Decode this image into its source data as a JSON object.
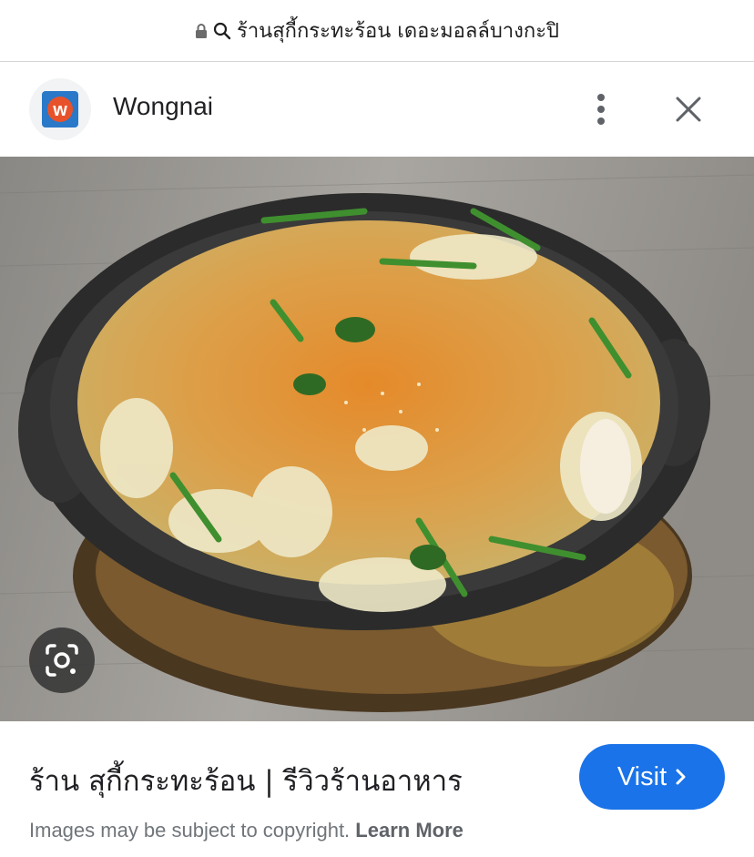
{
  "address_bar": {
    "url_text": "ร้านสุกี้กระทะร้อน เดอะมอลล์บางกะปิ",
    "lock_icon": "lock-icon",
    "search_icon": "search-icon"
  },
  "header": {
    "site_name": "Wongnai",
    "logo_letter": "w",
    "logo_color": "#e8522a",
    "logo_bg": "#2a78c8"
  },
  "image": {
    "description_icon": "lens-icon"
  },
  "result": {
    "title": "ร้าน สุกี้กระทะร้อน | รีวิวร้านอาหาร",
    "visit_label": "Visit"
  },
  "footer": {
    "notice": "Images may be subject to copyright.",
    "learn_more": "Learn More"
  },
  "colors": {
    "accent": "#1a73e8"
  }
}
